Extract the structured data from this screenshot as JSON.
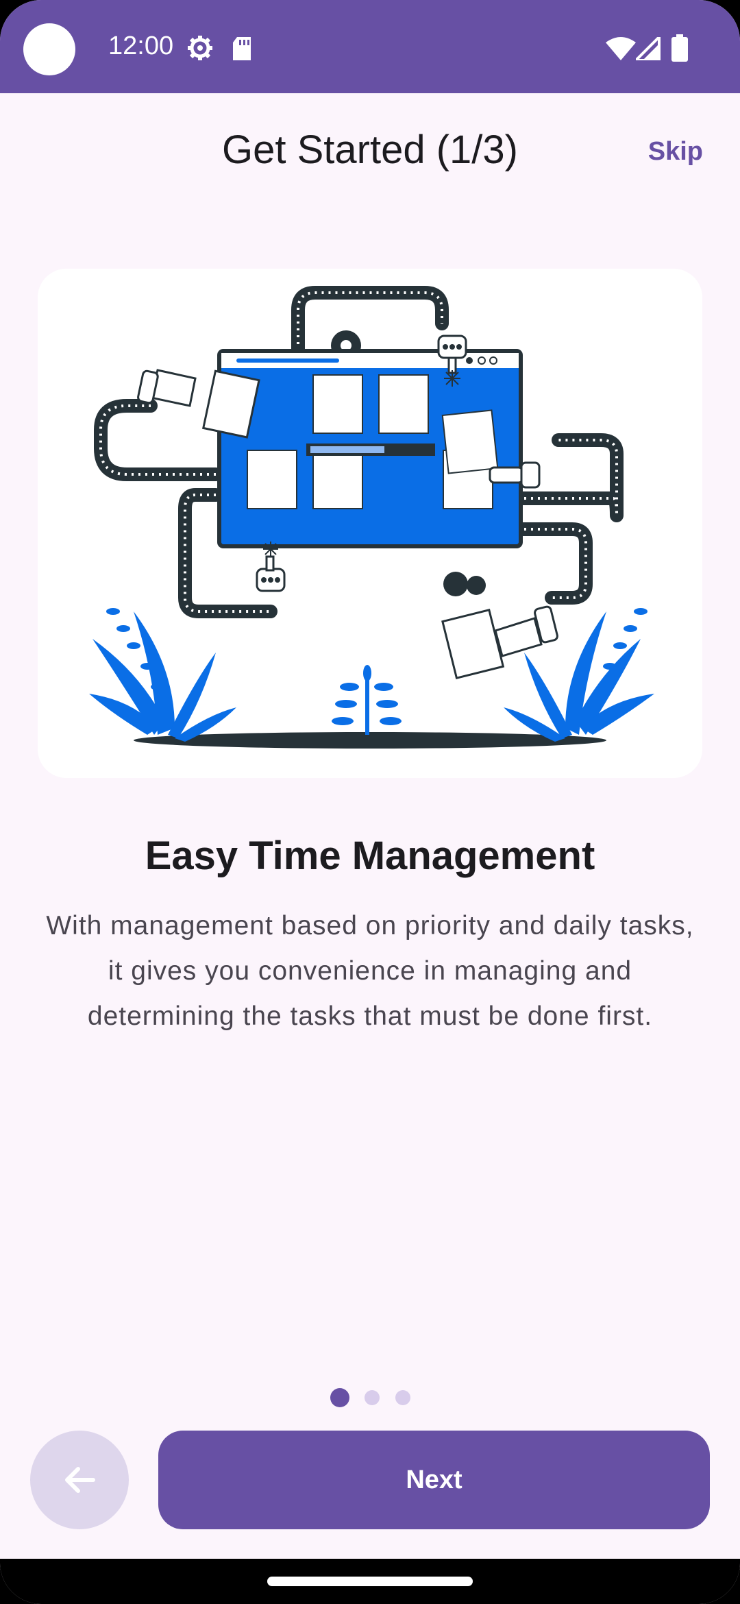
{
  "status_bar": {
    "time": "12:00",
    "icons": [
      "settings-gear-icon",
      "sd-card-icon",
      "wifi-icon",
      "signal-icon",
      "battery-icon"
    ]
  },
  "header": {
    "title": "Get Started (1/3)",
    "skip_label": "Skip"
  },
  "onboarding": {
    "illustration": "dashboard-tiles-robot-arms-plants-illustration",
    "headline": "Easy Time Management",
    "body": "With management based on priority and daily tasks, it gives you convenience in managing and determining the tasks that must be done first."
  },
  "pager": {
    "current_page": 1,
    "total_pages": 3
  },
  "footer": {
    "back_icon": "arrow-left-icon",
    "next_label": "Next"
  },
  "colors": {
    "primary": "#6750A4",
    "background": "#FCF5FC",
    "back_button_bg": "#DED6EC",
    "illustration_blue": "#0A6EE6",
    "illustration_dark": "#263238"
  }
}
